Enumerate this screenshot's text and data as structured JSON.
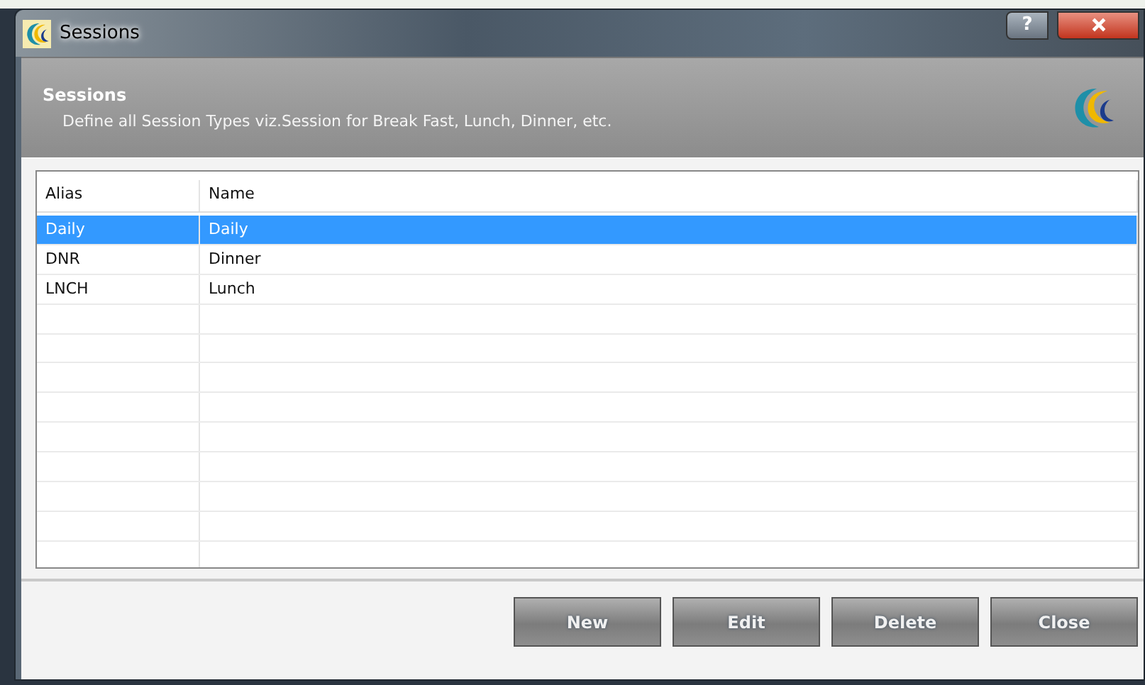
{
  "window": {
    "title": "Sessions",
    "help_glyph": "?"
  },
  "header": {
    "title": "Sessions",
    "description": "Define all Session Types viz.Session for Break Fast, Lunch, Dinner, etc."
  },
  "table": {
    "columns": [
      "Alias",
      "Name"
    ],
    "rows": [
      {
        "cells": [
          "Daily",
          "Daily"
        ],
        "selected": true
      },
      {
        "cells": [
          "DNR",
          "Dinner"
        ],
        "selected": false
      },
      {
        "cells": [
          "LNCH",
          "Lunch"
        ],
        "selected": false
      }
    ]
  },
  "buttons": [
    "New",
    "Edit",
    "Delete",
    "Close"
  ]
}
